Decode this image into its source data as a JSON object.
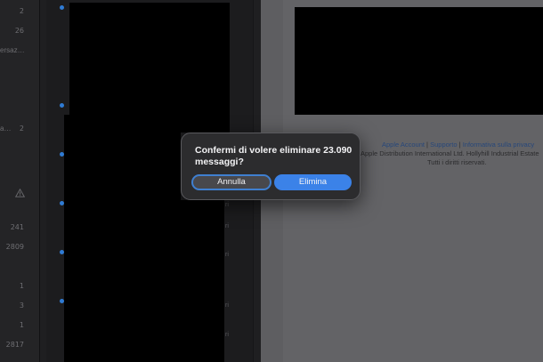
{
  "sidebar": {
    "counts": [
      "2",
      "26",
      "2",
      "241",
      "2809",
      "1",
      "3",
      "1",
      "2817"
    ],
    "cut_labels": [
      "ersaz…",
      "a…"
    ]
  },
  "list": {
    "crumbs": [
      "ri",
      "ri",
      "ri",
      "ri",
      "ri"
    ]
  },
  "footer": {
    "links": [
      "Apple Account",
      "Supporto",
      "Informativa sulla privacy"
    ],
    "separator": "|",
    "address": "Apple Distribution International Ltd. Hollyhill Industrial Estate",
    "rights": "Tutti i diritti riservati."
  },
  "dialog": {
    "message": "Confermi di volere eliminare 23.090 messaggi?",
    "cancel_label": "Annulla",
    "confirm_label": "Elimina"
  },
  "colors": {
    "accent": "#3b82e8",
    "unread_dot": "#2f7bd4",
    "link": "#27477a"
  },
  "icons": [
    "warning-icon"
  ]
}
